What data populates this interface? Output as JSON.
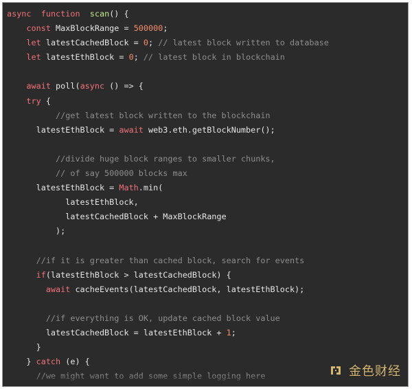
{
  "colors": {
    "background": "#2b2b2b",
    "default_text": "#e6e6e6",
    "keyword": "#f07178",
    "function": "#c3e88d",
    "number": "#f78c6c",
    "comment": "#8e8e8e",
    "watermark": "#e3c27a"
  },
  "code": {
    "lines": [
      [
        {
          "t": "async",
          "k": "kw"
        },
        {
          "t": "  ",
          "k": "id"
        },
        {
          "t": "function",
          "k": "kw"
        },
        {
          "t": "  ",
          "k": "id"
        },
        {
          "t": "scan",
          "k": "fn"
        },
        {
          "t": "() {",
          "k": "paren"
        }
      ],
      [
        {
          "t": "    ",
          "k": "id"
        },
        {
          "t": "const",
          "k": "kw"
        },
        {
          "t": " MaxBlockRange = ",
          "k": "id"
        },
        {
          "t": "500000",
          "k": "num"
        },
        {
          "t": ";",
          "k": "op"
        }
      ],
      [
        {
          "t": "    ",
          "k": "id"
        },
        {
          "t": "let",
          "k": "kw"
        },
        {
          "t": " latestCachedBlock = ",
          "k": "id"
        },
        {
          "t": "0",
          "k": "num"
        },
        {
          "t": "; ",
          "k": "op"
        },
        {
          "t": "// latest block written to database",
          "k": "comment"
        }
      ],
      [
        {
          "t": "    ",
          "k": "id"
        },
        {
          "t": "let",
          "k": "kw"
        },
        {
          "t": " latestEthBlock = ",
          "k": "id"
        },
        {
          "t": "0",
          "k": "num"
        },
        {
          "t": "; ",
          "k": "op"
        },
        {
          "t": "// latest block in blockchain",
          "k": "comment"
        }
      ],
      [
        {
          "t": "",
          "k": "id"
        }
      ],
      [
        {
          "t": "    ",
          "k": "id"
        },
        {
          "t": "await",
          "k": "kw"
        },
        {
          "t": " poll(",
          "k": "id"
        },
        {
          "t": "async",
          "k": "kw"
        },
        {
          "t": " () => {",
          "k": "id"
        }
      ],
      [
        {
          "t": "    ",
          "k": "id"
        },
        {
          "t": "try",
          "k": "kw"
        },
        {
          "t": " {",
          "k": "id"
        }
      ],
      [
        {
          "t": "          ",
          "k": "id"
        },
        {
          "t": "//get latest block written to the blockchain",
          "k": "comment"
        }
      ],
      [
        {
          "t": "      latestEthBlock = ",
          "k": "id"
        },
        {
          "t": "await",
          "k": "kw"
        },
        {
          "t": " web3.eth.getBlockNumber();",
          "k": "id"
        }
      ],
      [
        {
          "t": "",
          "k": "id"
        }
      ],
      [
        {
          "t": "          ",
          "k": "id"
        },
        {
          "t": "//divide huge block ranges to smaller chunks,",
          "k": "comment"
        }
      ],
      [
        {
          "t": "          ",
          "k": "id"
        },
        {
          "t": "// of say 500000 blocks max",
          "k": "comment"
        }
      ],
      [
        {
          "t": "      latestEthBlock = ",
          "k": "id"
        },
        {
          "t": "Math",
          "k": "class"
        },
        {
          "t": ".min(",
          "k": "id"
        }
      ],
      [
        {
          "t": "            latestEthBlock,",
          "k": "id"
        }
      ],
      [
        {
          "t": "            latestCachedBlock + MaxBlockRange",
          "k": "id"
        }
      ],
      [
        {
          "t": "          );",
          "k": "id"
        }
      ],
      [
        {
          "t": "",
          "k": "id"
        }
      ],
      [
        {
          "t": "      ",
          "k": "id"
        },
        {
          "t": "//if it is greater than cached block, search for events",
          "k": "comment"
        }
      ],
      [
        {
          "t": "      ",
          "k": "id"
        },
        {
          "t": "if",
          "k": "kw"
        },
        {
          "t": "(latestEthBlock > latestCachedBlock) {",
          "k": "id"
        }
      ],
      [
        {
          "t": "        ",
          "k": "id"
        },
        {
          "t": "await",
          "k": "kw"
        },
        {
          "t": " cacheEvents(latestCachedBlock, latestEthBlock);",
          "k": "id"
        }
      ],
      [
        {
          "t": "",
          "k": "id"
        }
      ],
      [
        {
          "t": "        ",
          "k": "id"
        },
        {
          "t": "//if everything is OK, update cached block value",
          "k": "comment"
        }
      ],
      [
        {
          "t": "        latestCachedBlock = latestEthBlock + ",
          "k": "id"
        },
        {
          "t": "1",
          "k": "num"
        },
        {
          "t": ";",
          "k": "op"
        }
      ],
      [
        {
          "t": "      }",
          "k": "id"
        }
      ],
      [
        {
          "t": "    } ",
          "k": "id"
        },
        {
          "t": "catch",
          "k": "kw"
        },
        {
          "t": " (e) {",
          "k": "id"
        }
      ],
      [
        {
          "t": "      ",
          "k": "id"
        },
        {
          "t": "//we might want to add some simple logging here",
          "k": "comment"
        }
      ]
    ]
  },
  "watermark": {
    "text": "金色财经",
    "icon": "jinse-logo-icon"
  }
}
